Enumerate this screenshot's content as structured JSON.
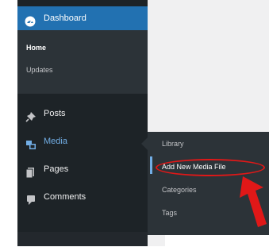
{
  "sidebar": {
    "dashboard": {
      "label": "Dashboard",
      "icon": "dashboard-icon"
    },
    "dashboard_submenu": [
      {
        "label": "Home",
        "current": true
      },
      {
        "label": "Updates",
        "current": false
      }
    ],
    "items": [
      {
        "label": "Posts",
        "icon": "pin-icon",
        "active": false
      },
      {
        "label": "Media",
        "icon": "media-icon",
        "active": true
      },
      {
        "label": "Pages",
        "icon": "pages-icon",
        "active": false
      },
      {
        "label": "Comments",
        "icon": "comments-icon",
        "active": false
      }
    ]
  },
  "flyout": {
    "items": [
      {
        "label": "Library"
      },
      {
        "label": "Add New Media File",
        "highlighted": true
      },
      {
        "label": "Categories"
      },
      {
        "label": "Tags"
      }
    ]
  },
  "annotation": {
    "color": "#e01818"
  },
  "colors": {
    "sidebar_bg": "#1d2327",
    "accent": "#2271b1",
    "active_text": "#72aee6"
  }
}
